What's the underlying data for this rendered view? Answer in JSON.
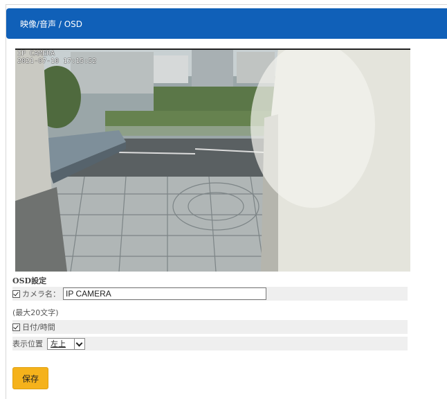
{
  "breadcrumb": "映像/音声 / OSD",
  "video": {
    "osd_name": "IP CAMERA",
    "osd_timestamp": "2021-07-10 17:15:52"
  },
  "osd_settings": {
    "section_title": "OSD設定",
    "camera_name_label": "カメラ名：",
    "camera_name_value": "IP CAMERA",
    "camera_name_checked": true,
    "max_length_note": "(最大20文字)",
    "datetime_label": "日付/時間",
    "datetime_checked": true,
    "position_label": "表示位置",
    "position_value": "左上"
  },
  "save_label": "保存",
  "colors": {
    "header_blue": "#1060b8",
    "save_orange": "#f5b21b"
  }
}
